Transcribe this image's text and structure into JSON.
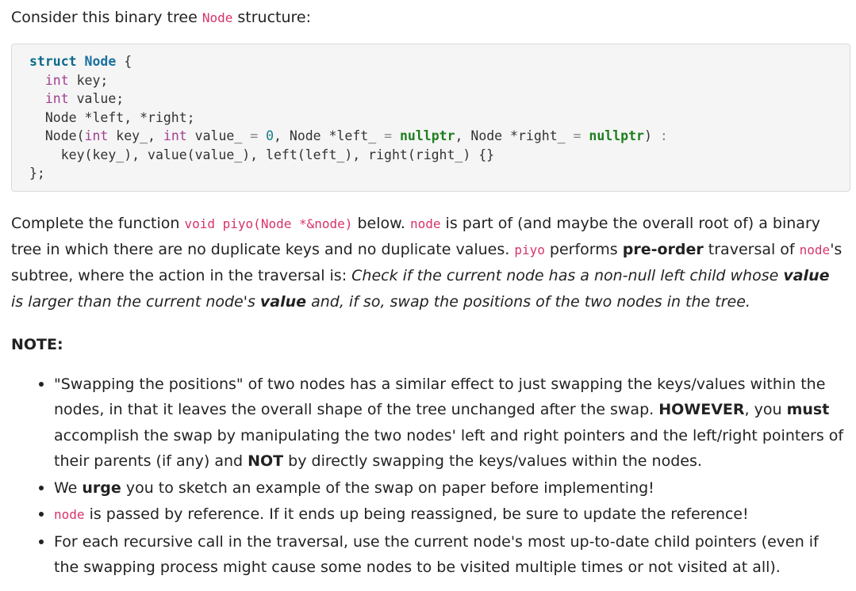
{
  "intro": {
    "before": "Consider this binary tree ",
    "code": "Node",
    "after": " structure:"
  },
  "code_lines": {
    "l1_kw": "struct",
    "l1_name": "Node",
    "l1_brace": " {",
    "l2_ty": "int",
    "l2_rest": " key;",
    "l3_ty": "int",
    "l3_rest": " value;",
    "l4": "  Node *left, *right;",
    "l5_a": "  Node(",
    "l5_ty1": "int",
    "l5_b": " key_, ",
    "l5_ty2": "int",
    "l5_c": " value_ ",
    "l5_eq1": "=",
    "l5_num": "0",
    "l5_d": ", Node *left_ ",
    "l5_eq2": "=",
    "l5_np1": "nullptr",
    "l5_e": ", Node *right_ ",
    "l5_eq3": "=",
    "l5_np2": "nullptr",
    "l5_f": ") ",
    "l5_colon": ":",
    "l6": "    key(key_), value(value_), left(left_), right(right_) {}",
    "l7": "};"
  },
  "para": {
    "t1": "Complete the function ",
    "c1": "void piyo(Node *&node)",
    "t2": " below. ",
    "c2": "node",
    "t3": " is part of (and maybe the overall root of) a binary tree in which there are no duplicate keys and no duplicate values. ",
    "c3": "piyo",
    "t4": " performs ",
    "b1": "pre-order",
    "t5": " traversal of ",
    "c4": "node",
    "t6": "'s subtree, where the action in the traversal is: ",
    "i1": "Check if the current node has a non-null left child whose ",
    "ib1": "value",
    "i2": " is larger than the current node's ",
    "ib2": "value",
    "i3": " and, if so, swap the positions of the two nodes in the tree."
  },
  "note_heading": "NOTE:",
  "bullets": {
    "b1_t1": "\"Swapping the positions\" of two nodes has a similar effect to just swapping the keys/values within the nodes, in that it leaves the overall shape of the tree unchanged after the swap. ",
    "b1_s1": "HOWEVER",
    "b1_t2": ", you ",
    "b1_s2": "must",
    "b1_t3": " accomplish the swap by manipulating the two nodes' left and right pointers and the left/right pointers of their parents (if any) and ",
    "b1_s3": "NOT",
    "b1_t4": " by directly swapping the keys/values within the nodes.",
    "b2_t1": "We ",
    "b2_s1": "urge",
    "b2_t2": " you to sketch an example of the swap on paper before implementing!",
    "b3_c1": "node",
    "b3_t1": " is passed by reference. If it ends up being reassigned, be sure to update the reference!",
    "b4_t1": "For each recursive call in the traversal, use the current node's most up-to-date child pointers (even if the swapping process might cause some nodes to be visited multiple times or not visited at all)."
  }
}
